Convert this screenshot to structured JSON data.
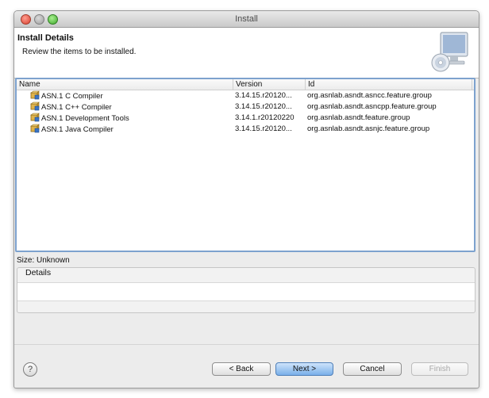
{
  "window": {
    "title": "Install"
  },
  "header": {
    "title": "Install Details",
    "subtitle": "Review the items to be installed.",
    "banner_icon": "monitor-cd-icon"
  },
  "table": {
    "columns": {
      "name": "Name",
      "version": "Version",
      "id": "Id"
    },
    "rows": [
      {
        "name": "ASN.1 C Compiler",
        "version": "3.14.15.r20120...",
        "id": "org.asnlab.asndt.asncc.feature.group"
      },
      {
        "name": "ASN.1 C++ Compiler",
        "version": "3.14.15.r20120...",
        "id": "org.asnlab.asndt.asncpp.feature.group"
      },
      {
        "name": "ASN.1 Development Tools",
        "version": "3.14.1.r20120220",
        "id": "org.asnlab.asndt.feature.group"
      },
      {
        "name": "ASN.1 Java Compiler",
        "version": "3.14.15.r20120...",
        "id": "org.asnlab.asndt.asnjc.feature.group"
      }
    ]
  },
  "size_label": "Size: Unknown",
  "details": {
    "title": "Details",
    "text": ""
  },
  "buttons": {
    "back": "< Back",
    "next": "Next >",
    "cancel": "Cancel",
    "finish": "Finish",
    "help": "?"
  },
  "colors": {
    "selection_border": "#7da2ce",
    "default_button": "#79afe9"
  }
}
